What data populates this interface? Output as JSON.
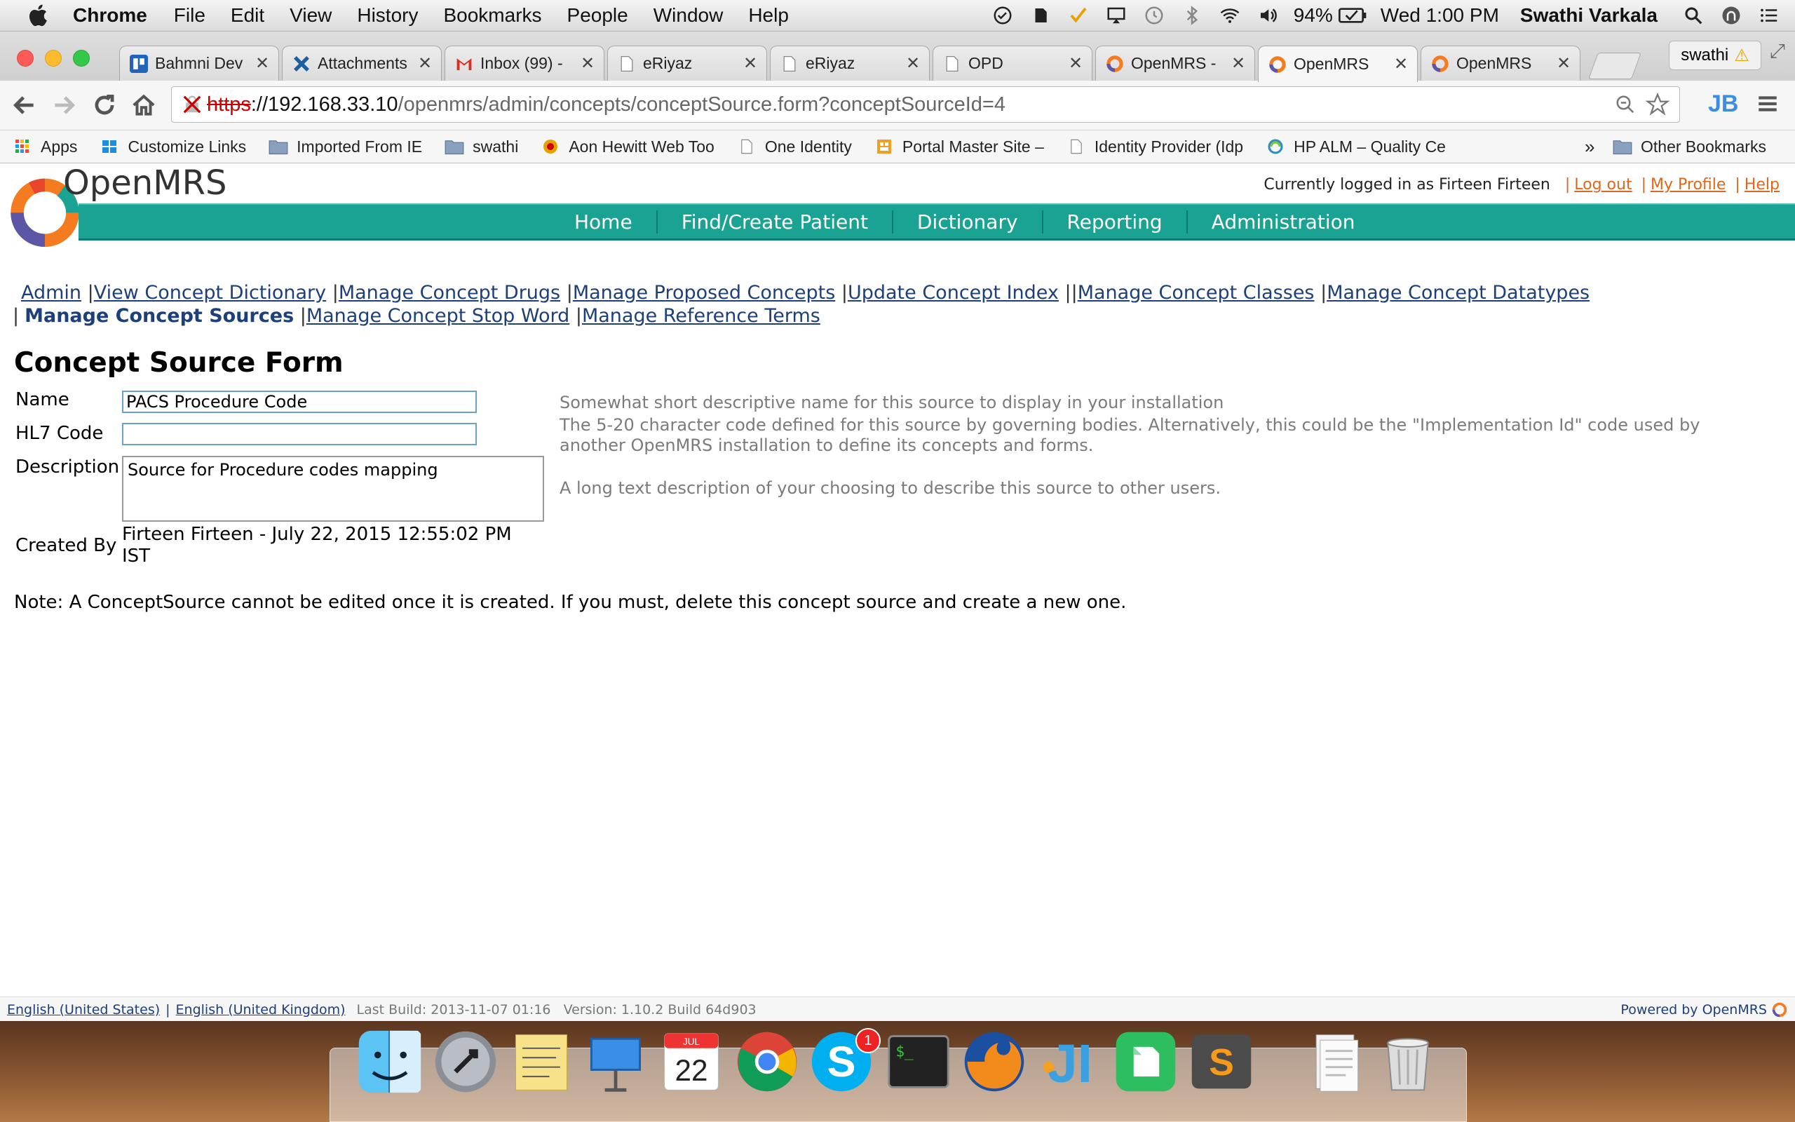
{
  "menubar": {
    "app": "Chrome",
    "items": [
      "File",
      "Edit",
      "View",
      "History",
      "Bookmarks",
      "People",
      "Window",
      "Help"
    ],
    "battery": "94%",
    "clock": "Wed 1:00 PM",
    "user": "Swathi Varkala"
  },
  "tabs": [
    {
      "title": "Bahmni Dev",
      "icon": "bahmni-icon"
    },
    {
      "title": "Attachments",
      "icon": "confluence-icon"
    },
    {
      "title": "Inbox (99) -",
      "icon": "gmail-icon"
    },
    {
      "title": "eRiyaz",
      "icon": "page-icon"
    },
    {
      "title": "eRiyaz",
      "icon": "page-icon"
    },
    {
      "title": "OPD",
      "icon": "page-icon"
    },
    {
      "title": "OpenMRS -",
      "icon": "openmrs-icon"
    },
    {
      "title": "OpenMRS",
      "icon": "openmrs-icon"
    },
    {
      "title": "OpenMRS",
      "icon": "openmrs-icon"
    }
  ],
  "profile": {
    "label": "swathi"
  },
  "omnibox": {
    "scheme": "https",
    "host": "://192.168.33.10",
    "path": "/openmrs/admin/concepts/conceptSource.form?conceptSourceId=4"
  },
  "bookmarks": [
    {
      "label": "Apps",
      "icon": "apps-grid-icon"
    },
    {
      "label": "Customize Links",
      "icon": "windows-icon"
    },
    {
      "label": "Imported From IE",
      "icon": "folder-icon"
    },
    {
      "label": "swathi",
      "icon": "folder-icon"
    },
    {
      "label": "Aon Hewitt Web Too",
      "icon": "aon-icon"
    },
    {
      "label": "One Identity",
      "icon": "page-icon"
    },
    {
      "label": "Portal Master Site –",
      "icon": "portal-icon"
    },
    {
      "label": "Identity Provider (Idp",
      "icon": "page-icon"
    },
    {
      "label": "HP ALM – Quality Ce",
      "icon": "hp-alm-icon"
    }
  ],
  "bookmarks_more": "»",
  "bookmarks_other": "Other Bookmarks",
  "header": {
    "logo_text": "OpenMRS",
    "logged_in": "Currently logged in as Firteen Firteen",
    "logout": "Log out",
    "profile": "My Profile",
    "help": "Help"
  },
  "nav": [
    "Home",
    "Find/Create Patient",
    "Dictionary",
    "Reporting",
    "Administration"
  ],
  "sublinks": {
    "admin": "Admin",
    "view_dict": "View Concept Dictionary",
    "drugs": "Manage Concept Drugs",
    "proposed": "Manage Proposed Concepts",
    "update_index": "Update Concept Index",
    "classes": "Manage Concept Classes",
    "datatypes": "Manage Concept Datatypes",
    "sources": "Manage Concept Sources",
    "stop_word": "Manage Concept Stop Word",
    "ref_terms": "Manage Reference Terms"
  },
  "form": {
    "title": "Concept Source Form",
    "name_label": "Name",
    "name_value": "PACS Procedure Code",
    "hl7_label": "HL7 Code",
    "hl7_value": "",
    "desc_label": "Description",
    "desc_value": "Source for Procedure codes mapping",
    "created_label": "Created By",
    "created_value": "Firteen Firteen - July 22, 2015 12:55:02 PM IST",
    "name_help": "Somewhat short descriptive name for this source to display in your installation",
    "hl7_help": "The 5-20 character code defined for this source by governing bodies. Alternatively, this could be the \"Implementation Id\" code used by another OpenMRS installation to define its concepts and forms.",
    "desc_help": "A long text description of your choosing to describe this source to other users.",
    "note": "Note: A ConceptSource cannot be edited once it is created. If you must, delete this concept source and create a new one."
  },
  "footer": {
    "lang_us": "English (United States)",
    "lang_uk": "English (United Kingdom)",
    "build": "Last Build: 2013-11-07 01:16   Version: 1.10.2 Build 64d903",
    "powered": "Powered by OpenMRS"
  },
  "dock": {
    "apps": [
      "finder-icon",
      "launchpad-icon",
      "stickies-icon",
      "keynote-icon",
      "calendar-icon",
      "chrome-icon",
      "skype-icon",
      "terminal-icon",
      "firefox-icon",
      "jira-icon",
      "evernote-icon",
      "sublime-icon",
      "documents-icon",
      "trash-icon"
    ],
    "skype_badge": "1",
    "calendar_day": "22",
    "calendar_month": "JUL"
  },
  "colors": {
    "nav_teal": "#1aa393",
    "link_blue": "#1d3f7a",
    "link_orange": "#e0661b"
  }
}
